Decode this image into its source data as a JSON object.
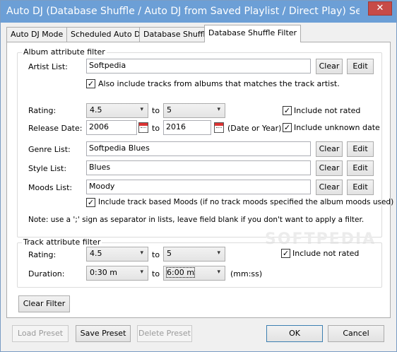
{
  "window": {
    "title": "Auto DJ (Database Shuffle / Auto DJ from Saved Playlist / Direct Play) Settin...",
    "close_glyph": "✕"
  },
  "tabs": [
    "Auto DJ Mode",
    "Scheduled Auto DJ",
    "Database Shuffle",
    "Database Shuffle Filter"
  ],
  "album_filter": {
    "title": "Album attribute filter",
    "artist_label": "Artist List:",
    "artist_value": "Softpedia",
    "also_include_label": "Also include tracks from albums that matches the track artist.",
    "also_include_checked": true,
    "rating_label": "Rating:",
    "rating_from": "4.5",
    "rating_to": "5",
    "to_label": "to",
    "include_not_rated_label": "Include not rated",
    "include_not_rated_checked": true,
    "release_label": "Release Date:",
    "release_from": "2006",
    "release_to": "2016",
    "date_or_year": "(Date or Year)",
    "include_unknown_label": "Include unknown date",
    "include_unknown_checked": true,
    "genre_label": "Genre List:",
    "genre_value": "Softpedia Blues",
    "style_label": "Style List:",
    "style_value": "Blues",
    "moods_label": "Moods List:",
    "moods_value": "Moody",
    "track_moods_label": "Include track based Moods (if no track moods specified the album moods used)",
    "track_moods_checked": true,
    "note": "Note: use a ';' sign as separator in lists, leave field blank if you don't want to apply a filter.",
    "clear_label": "Clear",
    "edit_label": "Edit"
  },
  "track_filter": {
    "title": "Track attribute filter",
    "rating_label": "Rating:",
    "rating_from": "4.5",
    "rating_to": "5",
    "to_label": "to",
    "include_not_rated_label": "Include not rated",
    "include_not_rated_checked": true,
    "duration_label": "Duration:",
    "duration_from": "0:30 m",
    "duration_to": "6:00 m",
    "unit": "(mm:ss)"
  },
  "clear_filter_label": "Clear Filter",
  "footer": {
    "load_preset": "Load Preset",
    "save_preset": "Save Preset",
    "delete_preset": "Delete Preset",
    "ok": "OK",
    "cancel": "Cancel"
  },
  "watermark": "SOFTPEDIA",
  "icons": {
    "dropdown": "▾",
    "check": "✓"
  },
  "colors": {
    "titlebar": "#6c9fd6",
    "close": "#c74b47"
  }
}
